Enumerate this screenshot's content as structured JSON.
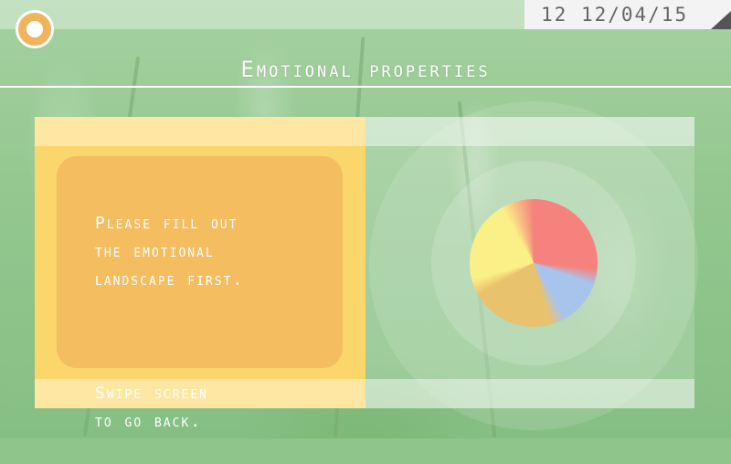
{
  "status": {
    "day": "12",
    "date": "12/04/15"
  },
  "header": {
    "title": "Emotional properties"
  },
  "message": {
    "line1": "Please fill out\nthe emotional\nlandscape first.",
    "line2": "Swipe screen\nto go back."
  },
  "colors": {
    "accent": "#f0b45f",
    "panel_yellow": "#fbd66a",
    "card_orange": "#f3bd60",
    "wheel_red": "#f6827d",
    "wheel_blue": "#a9c4ec",
    "wheel_gold": "#e9c26d",
    "wheel_yellow": "#fbef87"
  },
  "icons": {
    "home": "home-circle-icon",
    "wheel": "emotion-wheel-icon"
  }
}
